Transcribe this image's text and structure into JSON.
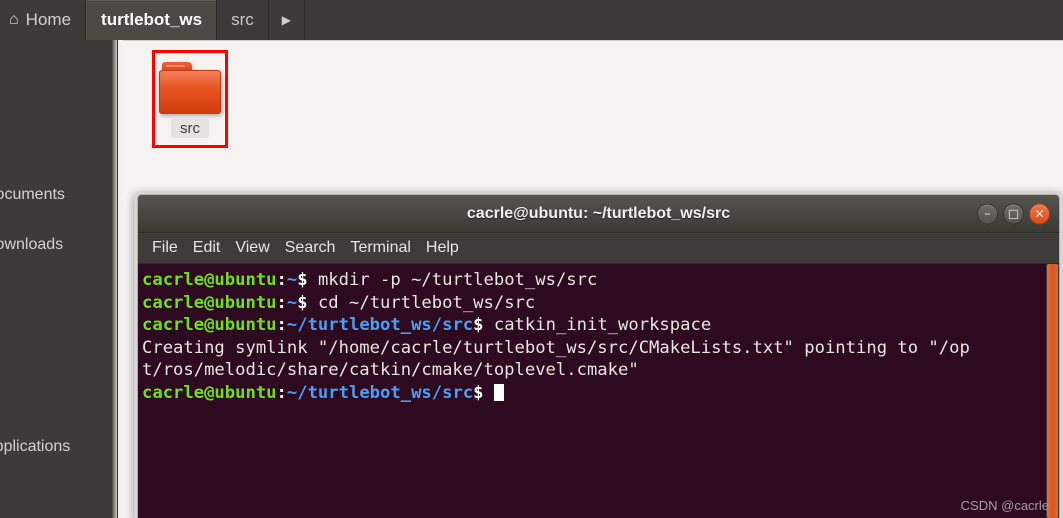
{
  "file_manager": {
    "pathbar": {
      "home_label": "Home",
      "home_icon": "home-icon",
      "crumbs": [
        {
          "label": "turtlebot_ws",
          "active": true
        },
        {
          "label": "src",
          "active": false
        }
      ],
      "overflow_arrow": "▶"
    },
    "sidebar": {
      "items": [
        {
          "label": "Documents"
        },
        {
          "label": "Downloads"
        },
        {
          "label": "Applications"
        }
      ]
    },
    "icon_view": {
      "items": [
        {
          "label": "src",
          "icon": "folder-icon",
          "selected": true
        }
      ]
    },
    "annotation": {
      "color": "#ff0000"
    }
  },
  "terminal": {
    "title": "cacrle@ubuntu: ~/turtlebot_ws/src",
    "window_controls": {
      "minimize": "–",
      "maximize": "□",
      "close": "×",
      "close_color": "#dc4e1b"
    },
    "menubar": [
      {
        "label": "File"
      },
      {
        "label": "Edit"
      },
      {
        "label": "View"
      },
      {
        "label": "Search"
      },
      {
        "label": "Terminal"
      },
      {
        "label": "Help"
      }
    ],
    "colors": {
      "background": "#2d0a20",
      "prompt_user": "#6ee018",
      "prompt_path": "#4b9ef5",
      "foreground": "#e8e4e2",
      "scrollbar": "#d9561f"
    },
    "lines": [
      {
        "type": "prompt",
        "user": "cacrle@ubuntu",
        "sep": ":",
        "path": "~",
        "dollar": "$ ",
        "command": "mkdir -p ~/turtlebot_ws/src"
      },
      {
        "type": "prompt",
        "user": "cacrle@ubuntu",
        "sep": ":",
        "path": "~",
        "dollar": "$ ",
        "command": "cd ~/turtlebot_ws/src"
      },
      {
        "type": "prompt",
        "user": "cacrle@ubuntu",
        "sep": ":",
        "path": "~/turtlebot_ws/src",
        "dollar": "$ ",
        "command": "catkin_init_workspace"
      },
      {
        "type": "output",
        "text": "Creating symlink \"/home/cacrle/turtlebot_ws/src/CMakeLists.txt\" pointing to \"/op"
      },
      {
        "type": "output",
        "text": "t/ros/melodic/share/catkin/cmake/toplevel.cmake\""
      },
      {
        "type": "prompt_cursor",
        "user": "cacrle@ubuntu",
        "sep": ":",
        "path": "~/turtlebot_ws/src",
        "dollar": "$ ",
        "command": ""
      }
    ]
  },
  "watermark": {
    "text": "CSDN @cacrle"
  }
}
